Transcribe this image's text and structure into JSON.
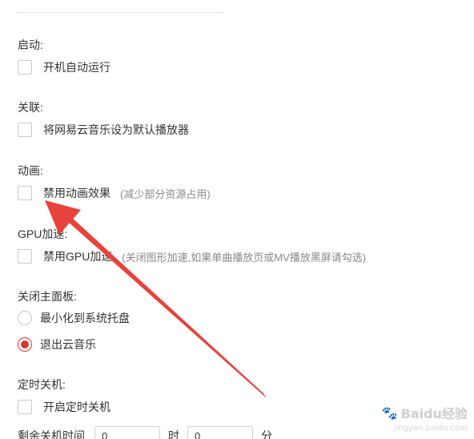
{
  "sections": {
    "startup": {
      "label": "启动:",
      "options": [
        {
          "text": "开机自动运行",
          "checked": false
        }
      ]
    },
    "association": {
      "label": "关联:",
      "options": [
        {
          "text": "将网易云音乐设为默认播放器",
          "checked": false
        }
      ]
    },
    "animation": {
      "label": "动画:",
      "options": [
        {
          "text": "禁用动画效果",
          "hint": "(减少部分资源占用)",
          "checked": false
        }
      ]
    },
    "gpu": {
      "label": "GPU加速:",
      "options": [
        {
          "text": "禁用GPU加速",
          "hint": "(关闭图形加速,如果单曲播放页或MV播放黑屏请勾选)",
          "checked": false
        }
      ]
    },
    "close_panel": {
      "label": "关闭主面板:",
      "options": [
        {
          "text": "最小化到系统托盘",
          "checked": false
        },
        {
          "text": "退出云音乐",
          "checked": true
        }
      ]
    },
    "timer": {
      "label": "定时关机:",
      "options": [
        {
          "text": "开启定时关机",
          "checked": false
        }
      ],
      "remaining_label": "剩余关机时间",
      "hours_value": "0",
      "hours_unit": "时",
      "minutes_value": "0",
      "minutes_unit": "分"
    }
  },
  "watermark": {
    "brand": "Baidu经验",
    "url": "jingyan.baidu.com"
  },
  "colors": {
    "accent": "#d33a31",
    "arrow": "#e8423b"
  }
}
